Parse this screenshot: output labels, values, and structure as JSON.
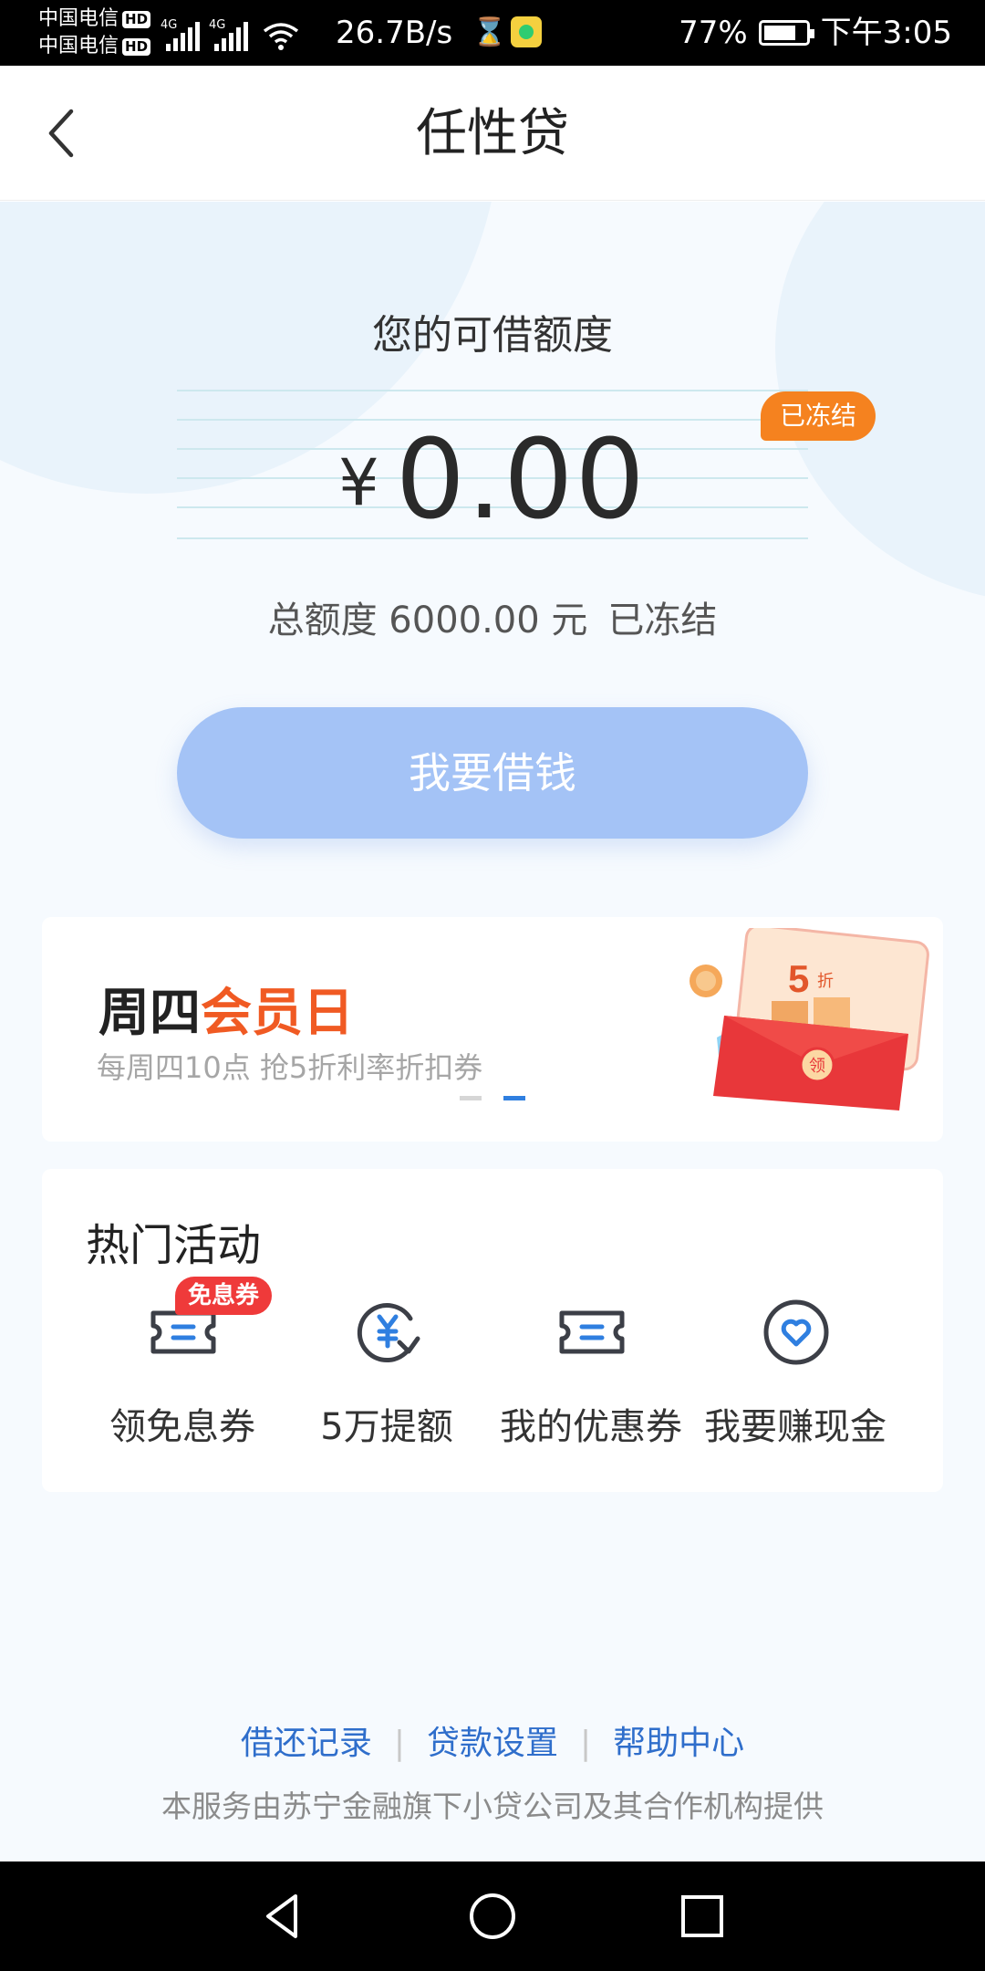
{
  "status_bar": {
    "carrier1": "中国电信",
    "carrier2": "中国电信",
    "hd_label": "HD",
    "network_tag": "4G",
    "speed": "26.7B/s",
    "battery": "77%",
    "time": "下午3:05"
  },
  "nav": {
    "title": "任性贷",
    "back_icon": "chevron-left-icon"
  },
  "credit": {
    "title": "您的可借额度",
    "currency": "¥",
    "amount": "0.00",
    "badge": "已冻结",
    "total_label": "总额度 6000.00 元",
    "total_status": "已冻结",
    "borrow_button": "我要借钱"
  },
  "banner": {
    "title_part1": "周四",
    "title_part2": "会员日",
    "subtitle": "每周四10点 抢5折利率折扣券",
    "active_dot": 1,
    "highlight_color": "#f05a23"
  },
  "hot": {
    "title": "热门活动",
    "items": [
      {
        "label": "领免息券",
        "icon": "coupon-icon",
        "tag": "免息券"
      },
      {
        "label": "5万提额",
        "icon": "yuan-up-icon"
      },
      {
        "label": "我的优惠券",
        "icon": "coupon-icon"
      },
      {
        "label": "我要赚现金",
        "icon": "heart-circle-icon"
      }
    ]
  },
  "footer": {
    "links": [
      "借还记录",
      "贷款设置",
      "帮助中心"
    ],
    "note": "本服务由苏宁金融旗下小贷公司及其合作机构提供"
  },
  "colors": {
    "accent": "#2f7fe0",
    "button": "#a4c3f6",
    "badge": "#f5821f",
    "link": "#2f6ecb"
  }
}
